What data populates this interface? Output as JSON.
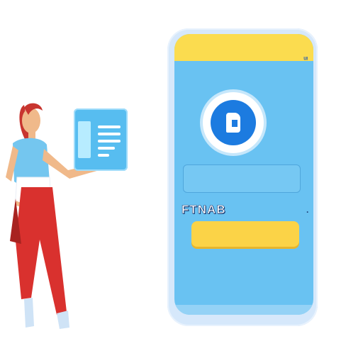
{
  "app": {
    "label": "FTNAB",
    "top_glyph": "ᵘᶦ",
    "right_glyph": "·",
    "login_field": {
      "value": "",
      "placeholder": ""
    }
  },
  "colors": {
    "phone_screen": "#69c2f2",
    "top_bar": "#fbdc4f",
    "primary_button": "#fbd347",
    "logo": "#1c7be0",
    "card": "#57bdf0",
    "person_shirt": "#74c6ef",
    "person_pants": "#d9312e"
  },
  "icons": {
    "logo": "app-logo-icon",
    "card": "document-card-icon"
  }
}
